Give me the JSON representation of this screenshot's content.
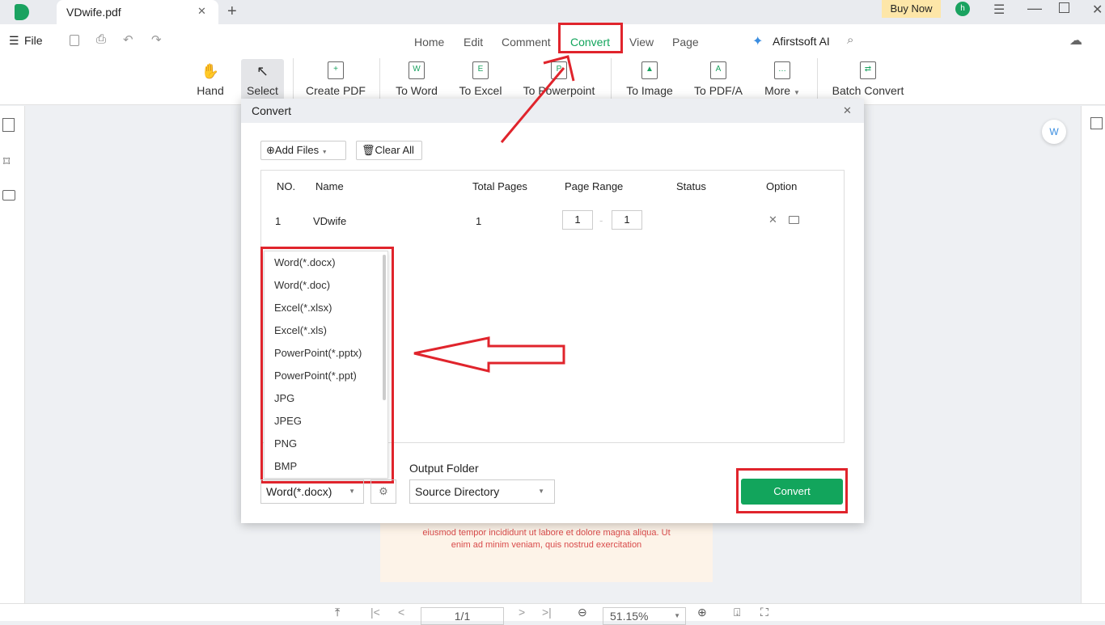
{
  "window": {
    "tab_title": "VDwife.pdf",
    "buy_now": "Buy Now",
    "avatar": "h",
    "accent": "#12a55c"
  },
  "menu": {
    "file": "File",
    "nav": [
      "Home",
      "Edit",
      "Comment",
      "Convert",
      "View",
      "Page"
    ],
    "active": "Convert",
    "ai": "Afirstsoft AI"
  },
  "toolbar": [
    "Hand",
    "Select",
    "Create PDF",
    "To Word",
    "To Excel",
    "To Powerpoint",
    "To Image",
    "To PDF/A",
    "More",
    "Batch Convert"
  ],
  "dialog": {
    "title": "Convert",
    "add_files": "Add Files",
    "clear_all": "Clear All",
    "columns": [
      "NO.",
      "Name",
      "Total Pages",
      "Page Range",
      "Status",
      "Option"
    ],
    "rows": [
      {
        "no": "1",
        "name": "VDwife",
        "pages": "1",
        "from": "1",
        "to": "1",
        "status": ""
      }
    ],
    "format_options": [
      "Word(*.docx)",
      "Word(*.doc)",
      "Excel(*.xlsx)",
      "Excel(*.xls)",
      "PowerPoint(*.pptx)",
      "PowerPoint(*.ppt)",
      "JPG",
      "JPEG",
      "PNG",
      "BMP"
    ],
    "format_selected": "Word(*.docx)",
    "output_folder_label": "Output Folder",
    "output_folder": "Source Directory",
    "convert": "Convert"
  },
  "document": {
    "line1": "eiusmod tempor incididunt ut labore et dolore magna aliqua. Ut",
    "line2": "enim ad minim veniam, quis nostrud exercitation"
  },
  "bottom": {
    "page": "1/1",
    "zoom": "51.15%"
  }
}
